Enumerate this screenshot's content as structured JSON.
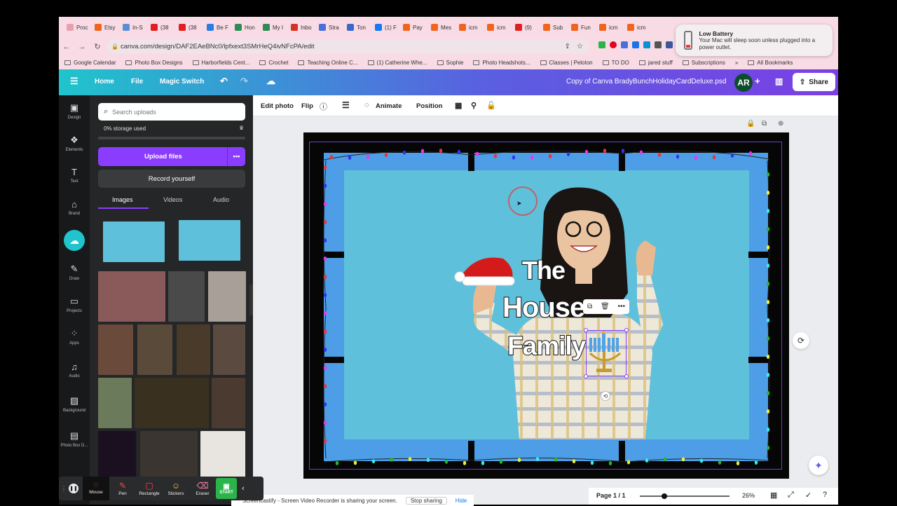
{
  "browser": {
    "tabs": [
      {
        "label": "Proc",
        "color": "#e8a0b0"
      },
      {
        "label": "Etsy",
        "color": "#f1641e"
      },
      {
        "label": "In-S",
        "color": "#5a8fd8"
      },
      {
        "label": "(38",
        "color": "#e02020"
      },
      {
        "label": "(38",
        "color": "#e02020"
      },
      {
        "label": "Be F",
        "color": "#2a7de1"
      },
      {
        "label": "Hon",
        "color": "#2e8b57"
      },
      {
        "label": "My I",
        "color": "#2e8b57"
      },
      {
        "label": "Inbo",
        "color": "#d93025"
      },
      {
        "label": "Stra",
        "color": "#4a6fd8"
      },
      {
        "label": "Ton",
        "color": "#3a6ac8"
      },
      {
        "label": "(1) F",
        "color": "#1877f2"
      },
      {
        "label": "Pay",
        "color": "#f1641e"
      },
      {
        "label": "Mes",
        "color": "#f1641e"
      },
      {
        "label": "icm",
        "color": "#f1641e"
      },
      {
        "label": "icm",
        "color": "#f1641e"
      },
      {
        "label": "(9)",
        "color": "#e02020"
      },
      {
        "label": "Sub",
        "color": "#f1641e"
      },
      {
        "label": "Fun",
        "color": "#f1641e"
      },
      {
        "label": "icm",
        "color": "#f1641e"
      },
      {
        "label": "icm",
        "color": "#f1641e"
      }
    ],
    "url": "canva.com/design/DAF2EAeBNc0/lpfxext3SMrHeQ4ivNFcPA/edit",
    "bookmarks": [
      {
        "label": "Google Calendar"
      },
      {
        "label": "Photo Box Designs"
      },
      {
        "label": "Harborfields Cent..."
      },
      {
        "label": "Crochet"
      },
      {
        "label": "Teaching Online C..."
      },
      {
        "label": "(1) Catherine Whe..."
      },
      {
        "label": "Sophie"
      },
      {
        "label": "Photo Headshots..."
      },
      {
        "label": "Classes | Peloton"
      },
      {
        "label": "TO DO"
      },
      {
        "label": "jared stuff"
      },
      {
        "label": "Subscriptions"
      }
    ],
    "all_bookmarks": "All Bookmarks",
    "overflow": "»"
  },
  "notification": {
    "title": "Low Battery",
    "body": "Your Mac will sleep soon unless plugged into a power outlet."
  },
  "canva_top": {
    "home": "Home",
    "file": "File",
    "magic_switch": "Magic Switch",
    "doc_title": "Copy of Canva BradyBunchHolidayCardDeluxe.psd",
    "avatar": "AR",
    "share": "Share"
  },
  "rail": [
    {
      "label": "Design",
      "icon": "▣"
    },
    {
      "label": "Elements",
      "icon": "❖"
    },
    {
      "label": "Text",
      "icon": "T"
    },
    {
      "label": "Brand",
      "icon": "⌂"
    },
    {
      "label": "",
      "icon": "☁"
    },
    {
      "label": "Draw",
      "icon": "✎"
    },
    {
      "label": "Projects",
      "icon": "▭"
    },
    {
      "label": "Apps",
      "icon": "⁘"
    },
    {
      "label": "Audio",
      "icon": "♫"
    },
    {
      "label": "Background",
      "icon": "▨"
    },
    {
      "label": "Photo Box D...",
      "icon": "▤"
    }
  ],
  "panel": {
    "search_placeholder": "Search uploads",
    "storage": "0% storage used",
    "upload": "Upload files",
    "record": "Record yourself",
    "tabs": [
      "Images",
      "Videos",
      "Audio"
    ]
  },
  "toolbar": {
    "edit_photo": "Edit photo",
    "flip": "Flip",
    "animate": "Animate",
    "position": "Position"
  },
  "design": {
    "line1": "The",
    "line2": "House",
    "line3": "Family"
  },
  "footer": {
    "page": "Page 1 / 1",
    "zoom": "26%",
    "zoom_level": 0.26
  },
  "drawbar": {
    "tools": [
      "Mouse",
      "Pen",
      "Rectangle",
      "Stickers",
      "Eraser"
    ],
    "start": "START"
  },
  "screencast": {
    "message": "Screencastify - Screen Video Recorder is sharing your screen.",
    "stop": "Stop sharing",
    "hide": "Hide"
  }
}
